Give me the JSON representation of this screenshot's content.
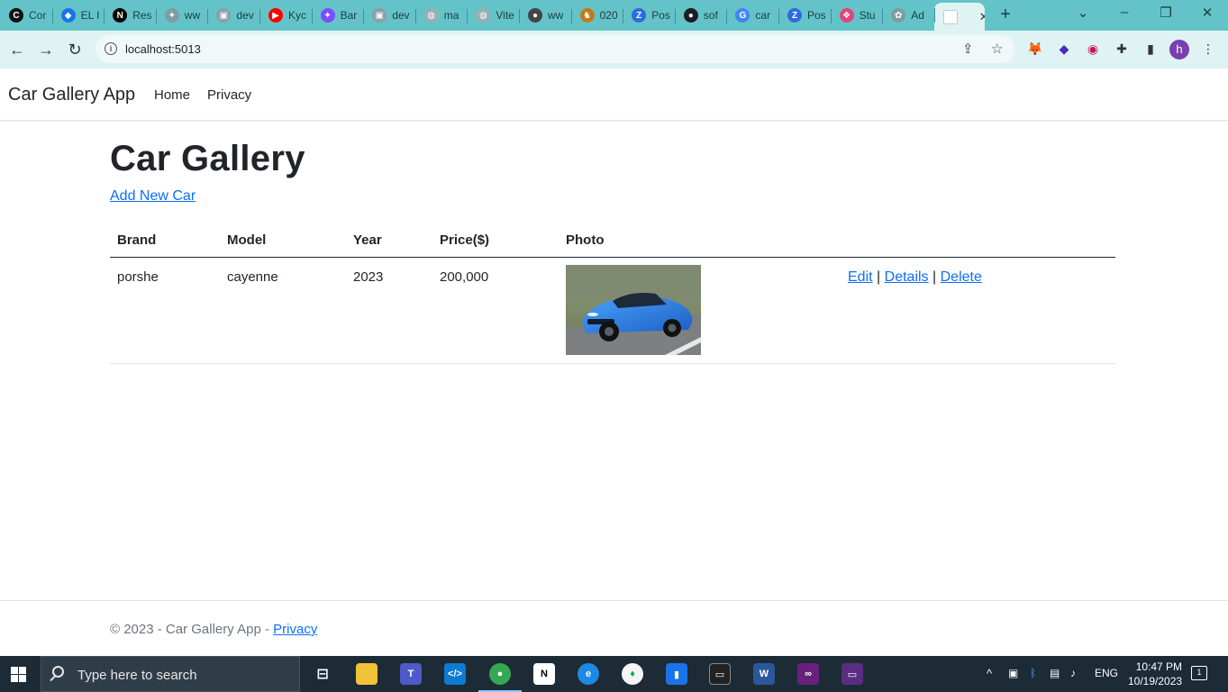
{
  "browser": {
    "tabs": [
      {
        "title": "Cor",
        "icon": "codepen-icon",
        "glyph": "C",
        "color": "#111111"
      },
      {
        "title": "EL I",
        "icon": "diamond-icon",
        "glyph": "◆",
        "color": "#1a73e8"
      },
      {
        "title": "Res",
        "icon": "nextjs-icon",
        "glyph": "N",
        "color": "#000000"
      },
      {
        "title": "ww",
        "icon": "puzzle-icon",
        "glyph": "✦",
        "color": "#7a9ea1"
      },
      {
        "title": "dev",
        "icon": "cube-icon",
        "glyph": "▣",
        "color": "#8a9fa2"
      },
      {
        "title": "Kyc",
        "icon": "youtube-icon",
        "glyph": "▶",
        "color": "#ff0000"
      },
      {
        "title": "Bar",
        "icon": "sparkle-icon",
        "glyph": "✦",
        "color": "#7c4dff"
      },
      {
        "title": "dev",
        "icon": "cube-icon",
        "glyph": "▣",
        "color": "#8a9fa2"
      },
      {
        "title": "ma",
        "icon": "globe-icon",
        "glyph": "◍",
        "color": "#9aaeb0"
      },
      {
        "title": "Vite",
        "icon": "globe-icon",
        "glyph": "◍",
        "color": "#9aaeb0"
      },
      {
        "title": "ww",
        "icon": "owl-icon",
        "glyph": "●",
        "color": "#444444"
      },
      {
        "title": "020",
        "icon": "horse-icon",
        "glyph": "♞",
        "color": "#c27a1a"
      },
      {
        "title": "Pos",
        "icon": "zotero-icon",
        "glyph": "Z",
        "color": "#2d6cdf"
      },
      {
        "title": "sof",
        "icon": "github-icon",
        "glyph": "●",
        "color": "#1b1f23"
      },
      {
        "title": "car",
        "icon": "google-icon",
        "glyph": "G",
        "color": "#4285f4"
      },
      {
        "title": "Pos",
        "icon": "zotero-icon",
        "glyph": "Z",
        "color": "#2d6cdf"
      },
      {
        "title": "Stu",
        "icon": "figma-icon",
        "glyph": "❖",
        "color": "#e0457b"
      },
      {
        "title": "Ad",
        "icon": "openai-icon",
        "glyph": "✿",
        "color": "#7d9c9e"
      },
      {
        "title": "",
        "icon": "page-icon",
        "glyph": "",
        "color": "#ffffff",
        "active": true
      }
    ],
    "url": "localhost:5013"
  },
  "site": {
    "brand": "Car Gallery App",
    "nav": [
      "Home",
      "Privacy"
    ]
  },
  "main": {
    "title": "Car Gallery",
    "add_link": "Add New Car",
    "columns": [
      "Brand",
      "Model",
      "Year",
      "Price($)",
      "Photo"
    ],
    "rows": [
      {
        "brand": "porshe",
        "model": "cayenne",
        "year": "2023",
        "price": "200,000",
        "photo_alt": "blue sports car",
        "actions": [
          "Edit",
          "Details",
          "Delete"
        ],
        "separator": "|"
      }
    ]
  },
  "footer": {
    "text": "© 2023 - Car Gallery App - ",
    "link": "Privacy"
  },
  "taskbar": {
    "search_placeholder": "Type here to search",
    "language": "ENG",
    "time": "10:47 PM",
    "date": "10/19/2023",
    "notification_count": "1"
  }
}
